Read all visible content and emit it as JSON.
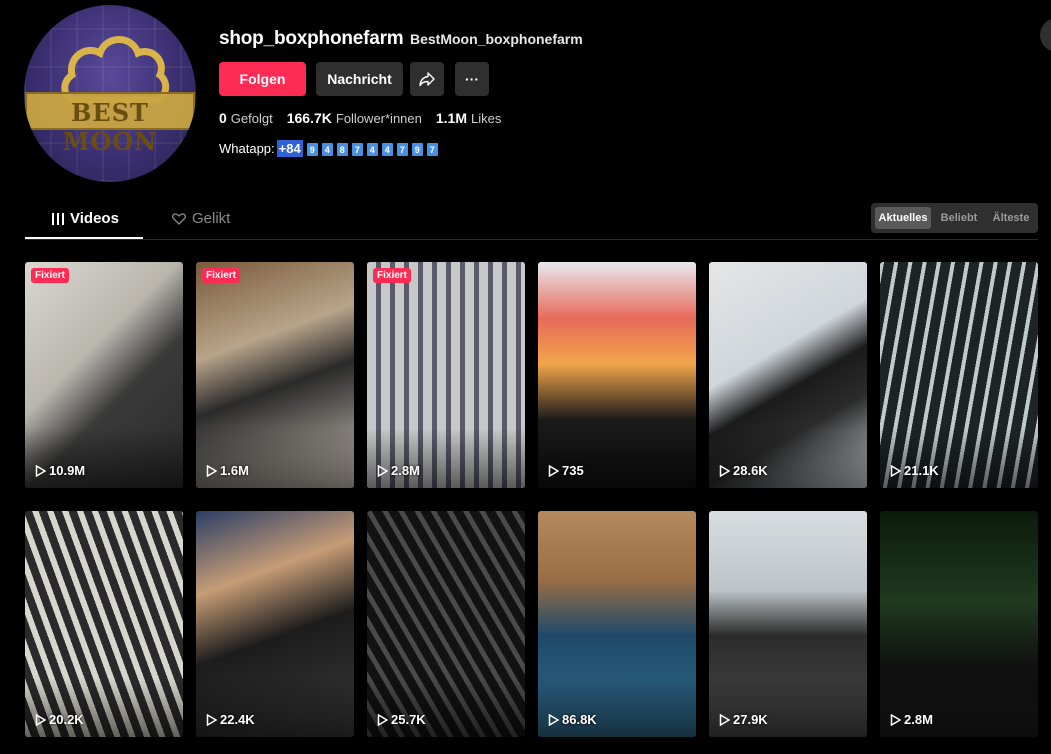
{
  "profile": {
    "username": "shop_boxphonefarm",
    "nickname": "BestMoon_boxphonefarm",
    "avatar_text": "BEST MOON",
    "follow_label": "Folgen",
    "message_label": "Nachricht",
    "share_icon": "share-icon",
    "more_label": "···",
    "stats": {
      "following_count": "0",
      "following_label": "Gefolgt",
      "followers_count": "166.7K",
      "followers_label": "Follower*innen",
      "likes_count": "1.1M",
      "likes_label": "Likes"
    },
    "bio": {
      "label": "Whatapp:",
      "prefix": "+84",
      "digits": [
        "9",
        "4",
        "8",
        "7",
        "4",
        "4",
        "7",
        "9",
        "7"
      ]
    }
  },
  "tabs": {
    "videos_label": "Videos",
    "liked_label": "Gelikt"
  },
  "sort": {
    "latest": "Aktuelles",
    "popular": "Beliebt",
    "oldest": "Älteste"
  },
  "videos": [
    {
      "views": "10.9M",
      "pinned": "Fixiert"
    },
    {
      "views": "1.6M",
      "pinned": "Fixiert"
    },
    {
      "views": "2.8M",
      "pinned": "Fixiert"
    },
    {
      "views": "735",
      "pinned": ""
    },
    {
      "views": "28.6K",
      "pinned": ""
    },
    {
      "views": "21.1K",
      "pinned": ""
    },
    {
      "views": "20.2K",
      "pinned": ""
    },
    {
      "views": "22.4K",
      "pinned": ""
    },
    {
      "views": "25.7K",
      "pinned": ""
    },
    {
      "views": "86.8K",
      "pinned": ""
    },
    {
      "views": "27.9K",
      "pinned": ""
    },
    {
      "views": "2.8M",
      "pinned": ""
    }
  ],
  "colors": {
    "accent": "#fe2c55",
    "button_dark": "#2f2f2f",
    "background": "#000000"
  }
}
